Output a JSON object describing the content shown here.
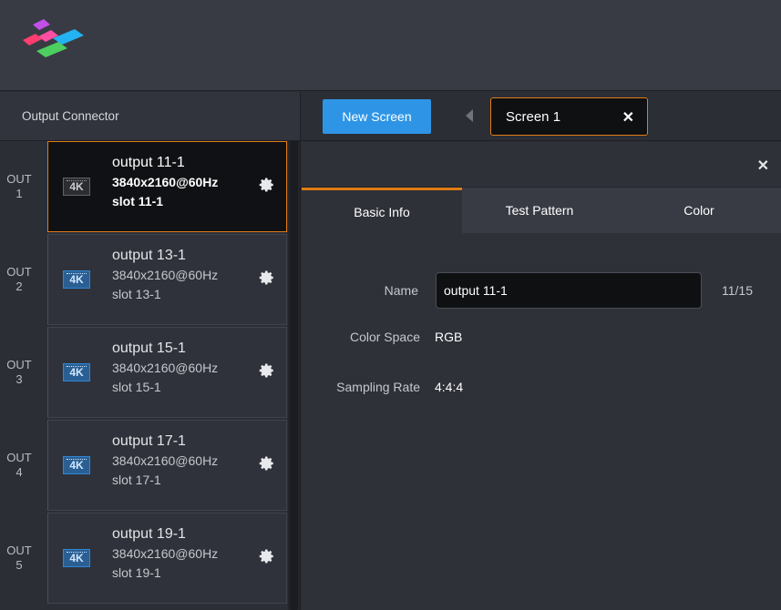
{
  "header": {
    "logo_icon": "novastar-logo"
  },
  "left_panel": {
    "title": "Output Connector",
    "outputs": [
      {
        "num_top": "OUT",
        "num_bottom": "1",
        "badge": "4K",
        "name": "output 11-1",
        "resolution": "3840x2160@60Hz",
        "slot": "slot 11-1",
        "selected": true
      },
      {
        "num_top": "OUT",
        "num_bottom": "2",
        "badge": "4K",
        "name": "output 13-1",
        "resolution": "3840x2160@60Hz",
        "slot": "slot 13-1",
        "selected": false
      },
      {
        "num_top": "OUT",
        "num_bottom": "3",
        "badge": "4K",
        "name": "output 15-1",
        "resolution": "3840x2160@60Hz",
        "slot": "slot 15-1",
        "selected": false
      },
      {
        "num_top": "OUT",
        "num_bottom": "4",
        "badge": "4K",
        "name": "output 17-1",
        "resolution": "3840x2160@60Hz",
        "slot": "slot 17-1",
        "selected": false
      },
      {
        "num_top": "OUT",
        "num_bottom": "5",
        "badge": "4K",
        "name": "output 19-1",
        "resolution": "3840x2160@60Hz",
        "slot": "slot 19-1",
        "selected": false
      }
    ]
  },
  "topbar": {
    "new_screen_label": "New Screen",
    "screen_tab_label": "Screen 1",
    "close_glyph": "✕"
  },
  "properties": {
    "close_glyph": "✕",
    "tabs": [
      {
        "label": "Basic Info",
        "active": true
      },
      {
        "label": "Test Pattern",
        "active": false
      },
      {
        "label": "Color",
        "active": false
      }
    ],
    "name_label": "Name",
    "name_value": "output 11-1",
    "name_counter": "11/15",
    "color_space_label": "Color Space",
    "color_space_value": "RGB",
    "sampling_rate_label": "Sampling Rate",
    "sampling_rate_value": "4:4:4"
  },
  "colors": {
    "accent_orange": "#e07b16",
    "accent_blue": "#2e95e6",
    "panel_bg": "#2b2e35"
  }
}
